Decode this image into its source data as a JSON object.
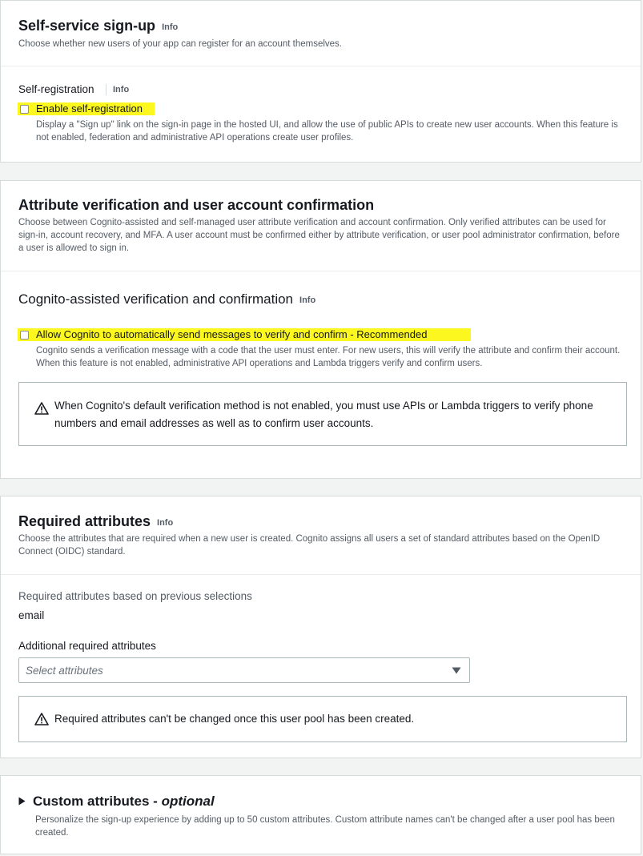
{
  "self_service": {
    "title": "Self-service sign-up",
    "info": "Info",
    "description": "Choose whether new users of your app can register for an account themselves.",
    "subtitle": "Self-registration",
    "sub_info": "Info",
    "checkbox_label": "Enable self-registration",
    "checkbox_checked": false,
    "help": "Display a \"Sign up\" link on the sign-in page in the hosted UI, and allow the use of public APIs to create new user accounts. When this feature is not enabled, federation and administrative API operations create user profiles."
  },
  "attr_verification": {
    "title": "Attribute verification and user account confirmation",
    "description": "Choose between Cognito-assisted and self-managed user attribute verification and account confirmation. Only verified attributes can be used for sign-in, account recovery, and MFA. A user account must be confirmed either by attribute verification, or user pool administrator confirmation, before a user is allowed to sign in.",
    "subtitle": "Cognito-assisted verification and confirmation",
    "sub_info": "Info",
    "checkbox_label": "Allow Cognito to automatically send messages to verify and confirm - Recommended",
    "checkbox_checked": false,
    "help": "Cognito sends a verification message with a code that the user must enter. For new users, this will verify the attribute and confirm their account. When this feature is not enabled, administrative API operations and Lambda triggers verify and confirm users.",
    "alert": "When Cognito's default verification method is not enabled, you must use APIs or Lambda triggers to verify phone numbers and email addresses as well as to confirm user accounts."
  },
  "required_attributes": {
    "title": "Required attributes",
    "info": "Info",
    "description": "Choose the attributes that are required when a new user is created. Cognito assigns all users a set of standard attributes based on the OpenID Connect (OIDC) standard.",
    "based_label": "Required attributes based on previous selections",
    "based_value": "email",
    "additional_label": "Additional required attributes",
    "select_placeholder": "Select attributes",
    "alert": "Required attributes can't be changed once this user pool has been created."
  },
  "custom_attributes": {
    "title": "Custom attributes - ",
    "title_optional": "optional",
    "description": "Personalize the sign-up experience by adding up to 50 custom attributes. Custom attribute names can't be changed after a user pool has been created."
  },
  "colors": {
    "highlight": "#fbf71f",
    "border": "#d5dbdb",
    "text": "#16191f",
    "muted": "#545b64"
  }
}
